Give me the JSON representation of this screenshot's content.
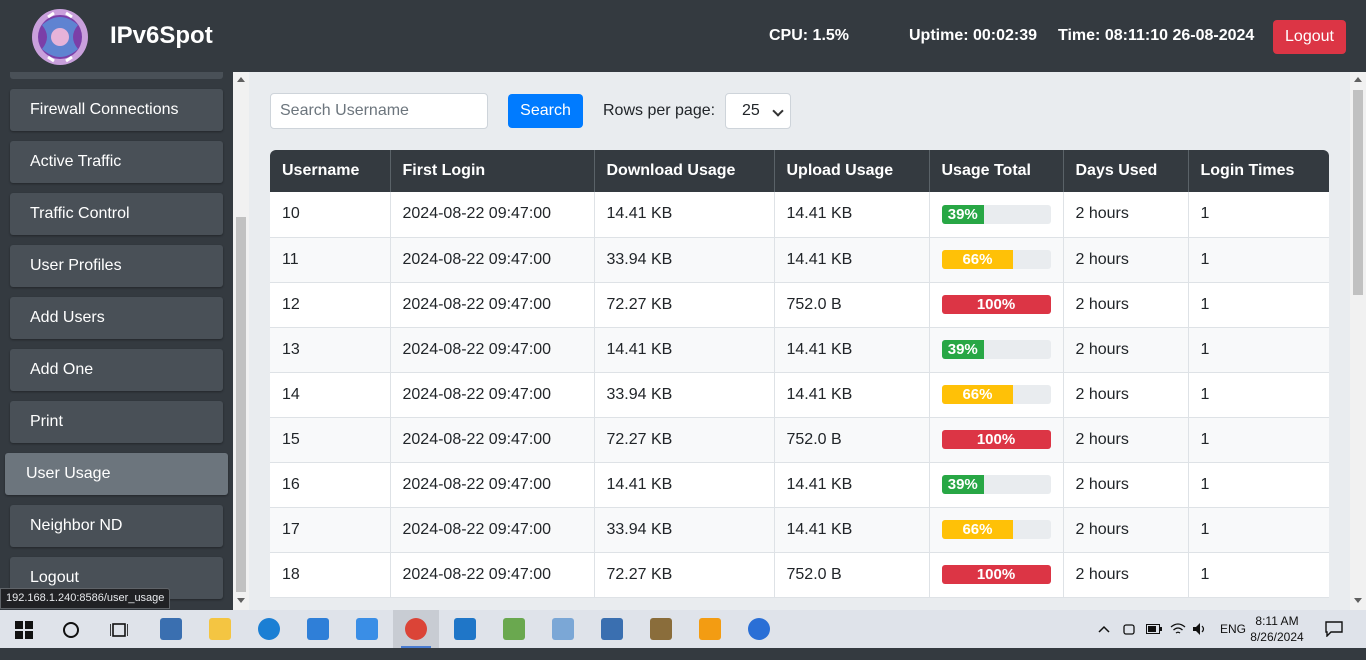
{
  "header": {
    "brand": "IPv6Spot",
    "cpu": "CPU: 1.5%",
    "uptime": "Uptime: 00:02:39",
    "time": "Time: 08:11:10 26-08-2024",
    "logout_label": "Logout"
  },
  "sidebar": {
    "items": [
      {
        "label": "Firewall Connections"
      },
      {
        "label": "Active Traffic"
      },
      {
        "label": "Traffic Control"
      },
      {
        "label": "User Profiles"
      },
      {
        "label": "Add Users"
      },
      {
        "label": "Add One"
      },
      {
        "label": "Print"
      },
      {
        "label": "User Usage"
      },
      {
        "label": "Neighbor ND"
      },
      {
        "label": "Logout"
      }
    ],
    "active_item": "User Usage"
  },
  "toolbar": {
    "search_placeholder": "Search Username",
    "search_label": "Search",
    "rows_label": "Rows per page:",
    "rows_value": "25"
  },
  "table": {
    "columns": [
      "Username",
      "First Login",
      "Download Usage",
      "Upload Usage",
      "Usage Total",
      "Days Used",
      "Login Times"
    ],
    "rows": [
      {
        "username": "10",
        "first_login": "2024-08-22 09:47:00",
        "download": "14.41 KB",
        "upload": "14.41 KB",
        "usage_pct": 39,
        "usage_label": "39%",
        "usage_color": "#28a745",
        "days_used": "2 hours",
        "login_times": "1"
      },
      {
        "username": "11",
        "first_login": "2024-08-22 09:47:00",
        "download": "33.94 KB",
        "upload": "14.41 KB",
        "usage_pct": 66,
        "usage_label": "66%",
        "usage_color": "#ffc107",
        "days_used": "2 hours",
        "login_times": "1"
      },
      {
        "username": "12",
        "first_login": "2024-08-22 09:47:00",
        "download": "72.27 KB",
        "upload": "752.0 B",
        "usage_pct": 100,
        "usage_label": "100%",
        "usage_color": "#dc3545",
        "days_used": "2 hours",
        "login_times": "1"
      },
      {
        "username": "13",
        "first_login": "2024-08-22 09:47:00",
        "download": "14.41 KB",
        "upload": "14.41 KB",
        "usage_pct": 39,
        "usage_label": "39%",
        "usage_color": "#28a745",
        "days_used": "2 hours",
        "login_times": "1"
      },
      {
        "username": "14",
        "first_login": "2024-08-22 09:47:00",
        "download": "33.94 KB",
        "upload": "14.41 KB",
        "usage_pct": 66,
        "usage_label": "66%",
        "usage_color": "#ffc107",
        "days_used": "2 hours",
        "login_times": "1"
      },
      {
        "username": "15",
        "first_login": "2024-08-22 09:47:00",
        "download": "72.27 KB",
        "upload": "752.0 B",
        "usage_pct": 100,
        "usage_label": "100%",
        "usage_color": "#dc3545",
        "days_used": "2 hours",
        "login_times": "1"
      },
      {
        "username": "16",
        "first_login": "2024-08-22 09:47:00",
        "download": "14.41 KB",
        "upload": "14.41 KB",
        "usage_pct": 39,
        "usage_label": "39%",
        "usage_color": "#28a745",
        "days_used": "2 hours",
        "login_times": "1"
      },
      {
        "username": "17",
        "first_login": "2024-08-22 09:47:00",
        "download": "33.94 KB",
        "upload": "14.41 KB",
        "usage_pct": 66,
        "usage_label": "66%",
        "usage_color": "#ffc107",
        "days_used": "2 hours",
        "login_times": "1"
      },
      {
        "username": "18",
        "first_login": "2024-08-22 09:47:00",
        "download": "72.27 KB",
        "upload": "752.0 B",
        "usage_pct": 100,
        "usage_label": "100%",
        "usage_color": "#dc3545",
        "days_used": "2 hours",
        "login_times": "1"
      }
    ]
  },
  "status_url": "192.168.1.240:8586/user_usage",
  "taskbar": {
    "apps": [
      {
        "icon": "network-tool-icon"
      },
      {
        "icon": "file-explorer-icon"
      },
      {
        "icon": "edge-browser-icon"
      },
      {
        "icon": "microsoft-store-icon"
      },
      {
        "icon": "mail-icon"
      },
      {
        "icon": "chrome-browser-icon"
      },
      {
        "icon": "vscode-icon"
      },
      {
        "icon": "notepad-plus-icon"
      },
      {
        "icon": "notebook-app-icon"
      },
      {
        "icon": "network-tool-2-icon"
      },
      {
        "icon": "remote-tool-icon"
      },
      {
        "icon": "terminal-app-icon"
      },
      {
        "icon": "globe-app-icon"
      }
    ],
    "active_app_index": 5,
    "language": "ENG",
    "clock_time": "8:11 AM",
    "clock_date": "8/26/2024"
  }
}
